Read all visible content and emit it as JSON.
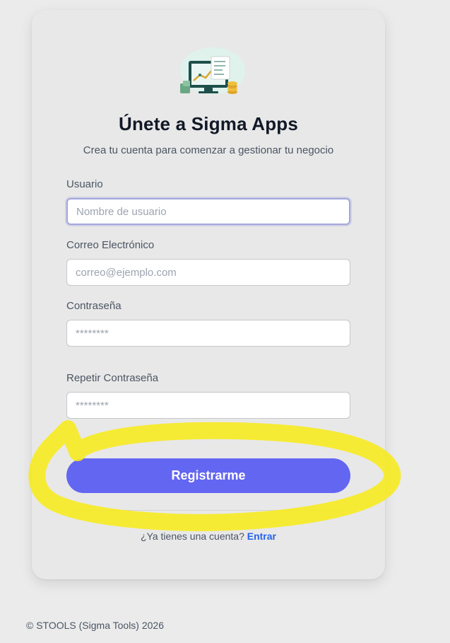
{
  "card": {
    "title": "Únete a Sigma Apps",
    "subtitle": "Crea tu cuenta para comenzar a gestionar tu negocio"
  },
  "form": {
    "username": {
      "label": "Usuario",
      "placeholder": "Nombre de usuario",
      "value": ""
    },
    "email": {
      "label": "Correo Electrónico",
      "placeholder": "correo@ejemplo.com",
      "value": ""
    },
    "password": {
      "label": "Contraseña",
      "placeholder": "********",
      "value": ""
    },
    "repeat_password": {
      "label": "Repetir Contraseña",
      "placeholder": "********",
      "value": ""
    },
    "submit_label": "Registrarme"
  },
  "login": {
    "prompt": "¿Ya tienes una cuenta?",
    "link_label": "Entrar"
  },
  "footer": {
    "text": "© STOOLS (Sigma Tools) 2026"
  },
  "colors": {
    "page_bg": "#ebebeb",
    "card_bg": "#e8e8e8",
    "primary": "#6366f1",
    "link": "#2563eb",
    "highlight": "#f7ea1a"
  },
  "icons": {
    "logo": "finance-dashboard-illustration"
  }
}
